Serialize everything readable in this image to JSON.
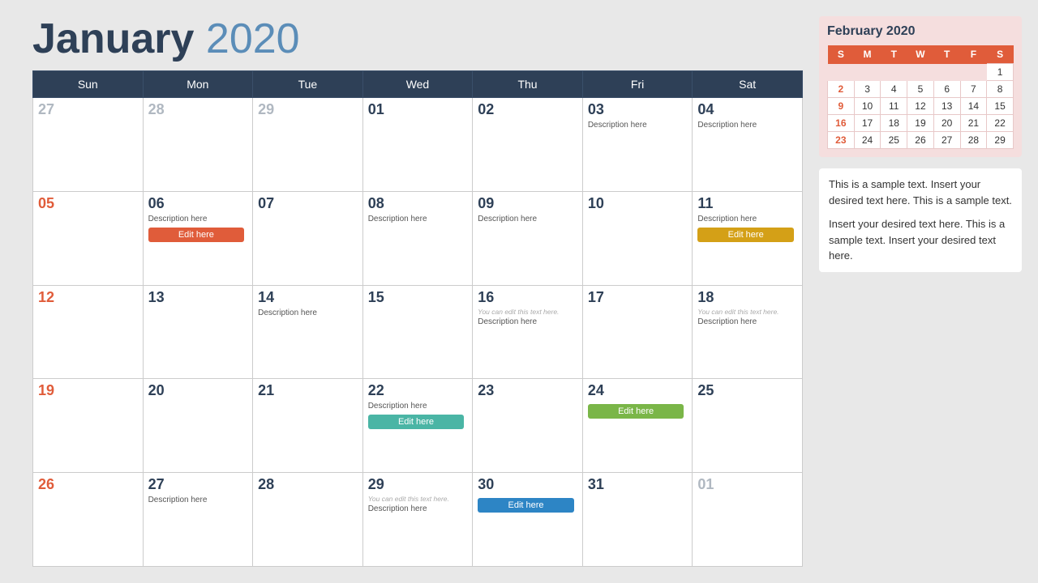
{
  "header": {
    "month": "January",
    "year": "2020",
    "title": "January 2020"
  },
  "weekdays": [
    "Sun",
    "Mon",
    "Tue",
    "Wed",
    "Thu",
    "Fri",
    "Sat"
  ],
  "weeks": [
    [
      {
        "day": "27",
        "outside": true
      },
      {
        "day": "28",
        "outside": true
      },
      {
        "day": "29",
        "outside": true
      },
      {
        "day": "01"
      },
      {
        "day": "02"
      },
      {
        "day": "03",
        "desc": "Description here"
      },
      {
        "day": "04",
        "desc": "Description here"
      }
    ],
    [
      {
        "day": "05",
        "sunday": true
      },
      {
        "day": "06",
        "desc": "Description here",
        "btn": "Edit here",
        "btnColor": "orange"
      },
      {
        "day": "07"
      },
      {
        "day": "08",
        "desc": "Description here"
      },
      {
        "day": "09",
        "desc": "Description here"
      },
      {
        "day": "10"
      },
      {
        "day": "11",
        "desc": "Description here",
        "btn": "Edit here",
        "btnColor": "yellow"
      }
    ],
    [
      {
        "day": "12",
        "sunday": true
      },
      {
        "day": "13"
      },
      {
        "day": "14",
        "desc": "Description here"
      },
      {
        "day": "15"
      },
      {
        "day": "16",
        "hint": "You can edit this text here.",
        "desc": "Description here"
      },
      {
        "day": "17"
      },
      {
        "day": "18",
        "hint": "You can edit this text here.",
        "desc": "Description here"
      }
    ],
    [
      {
        "day": "19",
        "sunday": true
      },
      {
        "day": "20"
      },
      {
        "day": "21"
      },
      {
        "day": "22",
        "desc": "Description here",
        "btn": "Edit here",
        "btnColor": "teal"
      },
      {
        "day": "23"
      },
      {
        "day": "24",
        "btn": "Edit here",
        "btnColor": "green"
      },
      {
        "day": "25"
      }
    ],
    [
      {
        "day": "26",
        "sunday": true
      },
      {
        "day": "27",
        "desc": "Description here"
      },
      {
        "day": "28"
      },
      {
        "day": "29",
        "hint": "You can edit this text here.",
        "desc": "Description here"
      },
      {
        "day": "30",
        "btn": "Edit here",
        "btnColor": "blue"
      },
      {
        "day": "31"
      },
      {
        "day": "01",
        "outside": true
      }
    ]
  ],
  "sidebar": {
    "mini_title": "February 2020",
    "mini_weekdays": [
      "S",
      "M",
      "T",
      "W",
      "T",
      "F",
      "S"
    ],
    "mini_weeks": [
      [
        "",
        "",
        "",
        "",
        "",
        "",
        "1"
      ],
      [
        "2",
        "3",
        "4",
        "5",
        "6",
        "7",
        "8"
      ],
      [
        "9",
        "10",
        "11",
        "12",
        "13",
        "14",
        "15"
      ],
      [
        "16",
        "17",
        "18",
        "19",
        "20",
        "21",
        "22"
      ],
      [
        "23",
        "24",
        "25",
        "26",
        "27",
        "28",
        "29"
      ]
    ],
    "text1": "This is a sample text. Insert your desired text here. This is a sample text.",
    "text2": "Insert your desired text here. This is a sample text. Insert your desired text here."
  }
}
